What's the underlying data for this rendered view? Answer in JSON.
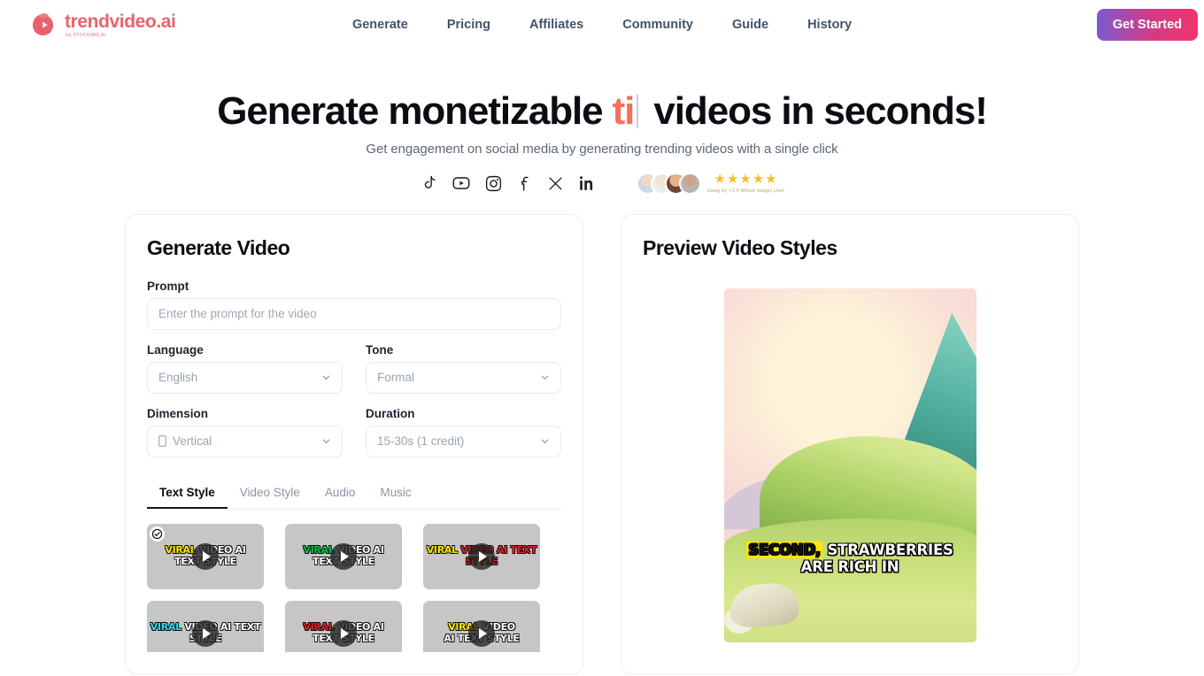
{
  "header": {
    "logo_text": "trendvideo.ai",
    "logo_sub": "by STOCKIMG.AI",
    "nav": [
      {
        "label": "Generate"
      },
      {
        "label": "Pricing"
      },
      {
        "label": "Affiliates"
      },
      {
        "label": "Community"
      },
      {
        "label": "Guide"
      },
      {
        "label": "History"
      }
    ],
    "cta_label": "Get Started"
  },
  "hero": {
    "title_before": "Generate monetizable ",
    "typed_word": "ti",
    "title_after": " videos in seconds!",
    "subtitle": "Get engagement on social media by generating trending videos with a single click",
    "social_icons": [
      "tiktok-icon",
      "youtube-icon",
      "instagram-icon",
      "facebook-icon",
      "x-icon",
      "linkedin-icon"
    ],
    "stars": "★★★★★",
    "proof_text": "Using by +2.5 Million Happy User"
  },
  "generate_panel": {
    "title": "Generate Video",
    "prompt_label": "Prompt",
    "prompt_value": "",
    "prompt_placeholder": "Enter the prompt for the video",
    "language_label": "Language",
    "language_value": "English",
    "tone_label": "Tone",
    "tone_value": "Formal",
    "dimension_label": "Dimension",
    "dimension_value": "Vertical",
    "duration_label": "Duration",
    "duration_value": "15-30s (1 credit)",
    "tabs": [
      {
        "label": "Text Style",
        "active": true
      },
      {
        "label": "Video Style",
        "active": false
      },
      {
        "label": "Audio",
        "active": false
      },
      {
        "label": "Music",
        "active": false
      }
    ],
    "styles": [
      {
        "word": "VIRAL",
        "word_color": "#ffe600",
        "rest": " VIDEO AI",
        "line2": "TEXT STYLE",
        "rest_color": "#ffffff",
        "selected": true
      },
      {
        "word": "VIRAL",
        "word_color": "#00c53c",
        "rest": " VIDEO AI",
        "line2": "TEXT STYLE",
        "rest_color": "#ffffff",
        "selected": false
      },
      {
        "word": "VIRAL",
        "word_color": "#ffe600",
        "rest": " VIDEO AI TEXT",
        "line2": "STYLE",
        "rest_color": "#e81c20",
        "selected": false
      },
      {
        "word": "VIRAL",
        "word_color": "#2fd8f0",
        "rest": " VIDEO AI TEXT",
        "line2": "STYLE",
        "rest_color": "#ffffff",
        "selected": false
      },
      {
        "word": "VIRAL",
        "word_color": "#e81c20",
        "rest": " VIDEO AI",
        "line2": "TEXT STYLE",
        "rest_color": "#ffffff",
        "selected": false
      },
      {
        "word": "VIRAL",
        "word_color": "#ffe600",
        "rest": " VIDEO",
        "line2": "AI TEXT STYLE",
        "rest_color": "#ffffff",
        "selected": false
      }
    ]
  },
  "preview_panel": {
    "title": "Preview Video Styles",
    "caption_highlight": "SECOND,",
    "caption_rest": " STRAWBERRIES",
    "caption_line2": "ARE RICH IN"
  },
  "colors": {
    "brand": "#e8626e",
    "accent": "#f4705f",
    "cta_start": "#7b5ad0",
    "cta_end": "#f0356a",
    "nav_text": "#43536b"
  }
}
